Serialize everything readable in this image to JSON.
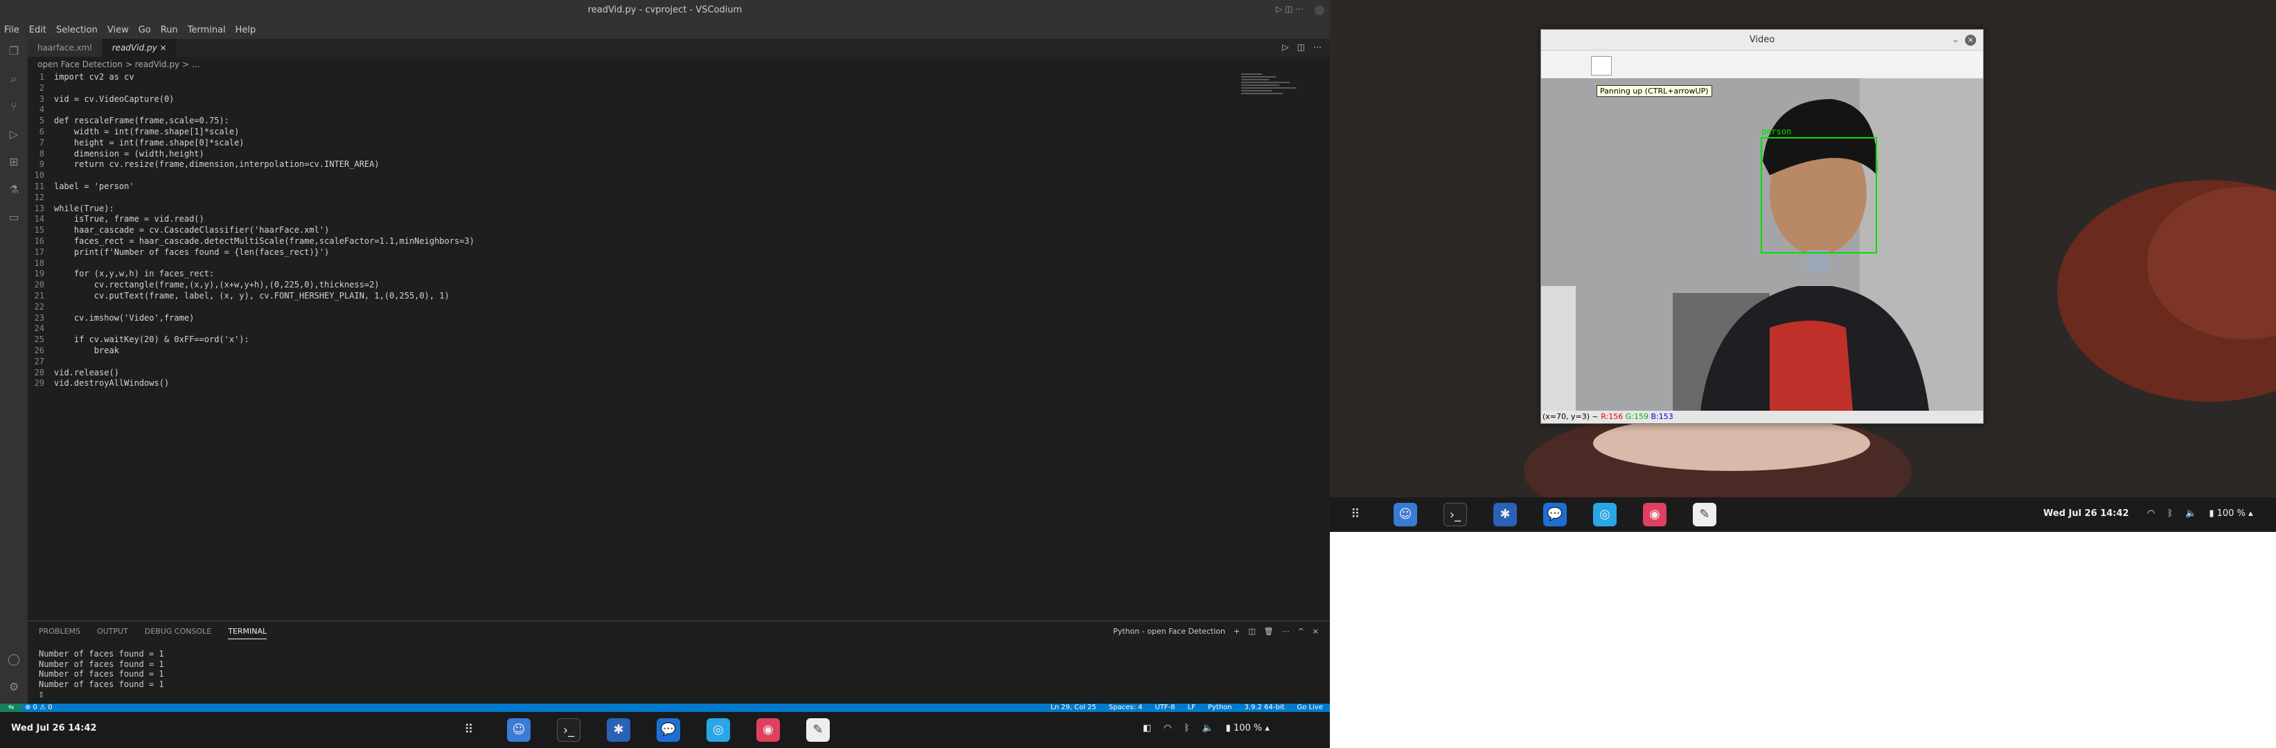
{
  "window_title": "readVid.py - cvproject - VSCodium",
  "menu": [
    "File",
    "Edit",
    "Selection",
    "View",
    "Go",
    "Run",
    "Terminal",
    "Help"
  ],
  "tabs": [
    {
      "label": "haarface.xml"
    },
    {
      "label": "readVid.py"
    }
  ],
  "breadcrumb": "open Face Detection  >  readVid.py  >  ...",
  "code": [
    "import cv2 as cv",
    "",
    "vid = cv.VideoCapture(0)",
    "",
    "def rescaleFrame(frame,scale=0.75):",
    "    width = int(frame.shape[1]*scale)",
    "    height = int(frame.shape[0]*scale)",
    "    dimension = (width,height)",
    "    return cv.resize(frame,dimension,interpolation=cv.INTER_AREA)",
    "",
    "label = 'person'",
    "",
    "while(True):",
    "    isTrue, frame = vid.read()",
    "    haar_cascade = cv.CascadeClassifier('haarFace.xml')",
    "    faces_rect = haar_cascade.detectMultiScale(frame,scaleFactor=1.1,minNeighbors=3)",
    "    print(f'Number of faces found = {len(faces_rect)}')",
    "",
    "    for (x,y,w,h) in faces_rect:",
    "        cv.rectangle(frame,(x,y),(x+w,y+h),(0,225,0),thickness=2)",
    "        cv.putText(frame, label, (x, y), cv.FONT_HERSHEY_PLAIN, 1,(0,255,0), 1)",
    "",
    "    cv.imshow('Video',frame)",
    "",
    "    if cv.waitKey(20) & 0xFF==ord('x'):",
    "        break",
    "",
    "vid.release()",
    "vid.destroyAllWindows()"
  ],
  "panel_tabs": [
    "PROBLEMS",
    "OUTPUT",
    "DEBUG CONSOLE",
    "TERMINAL"
  ],
  "terminal_label": "Python - open Face Detection",
  "terminal_lines": [
    "Number of faces found = 1",
    "Number of faces found = 1",
    "Number of faces found = 1",
    "Number of faces found = 1"
  ],
  "status": {
    "left": "⊗ 0 ⚠ 0",
    "right": [
      "Ln 29, Col 25",
      "Spaces: 4",
      "UTF-8",
      "LF",
      "Python",
      "3.9.2 64-bit",
      "Go Live"
    ]
  },
  "taskbar_left": {
    "clock": "Wed Jul 26  14:42",
    "battery": "100 %"
  },
  "taskbar_right": {
    "clock": "Wed Jul 26  14:42",
    "battery": "100 %"
  },
  "video_window": {
    "title": "Video",
    "tooltip": "Panning up (CTRL+arrowUP)",
    "face_label": "person",
    "status_coords": "(x=70, y=3) ~",
    "status_r": "R:156",
    "status_g": "G:159",
    "status_b": "B:153"
  },
  "colors": {
    "accent": "#007acc",
    "box": "#00e100",
    "r": "#e00000",
    "g": "#00b000",
    "b": "#0000e0"
  }
}
